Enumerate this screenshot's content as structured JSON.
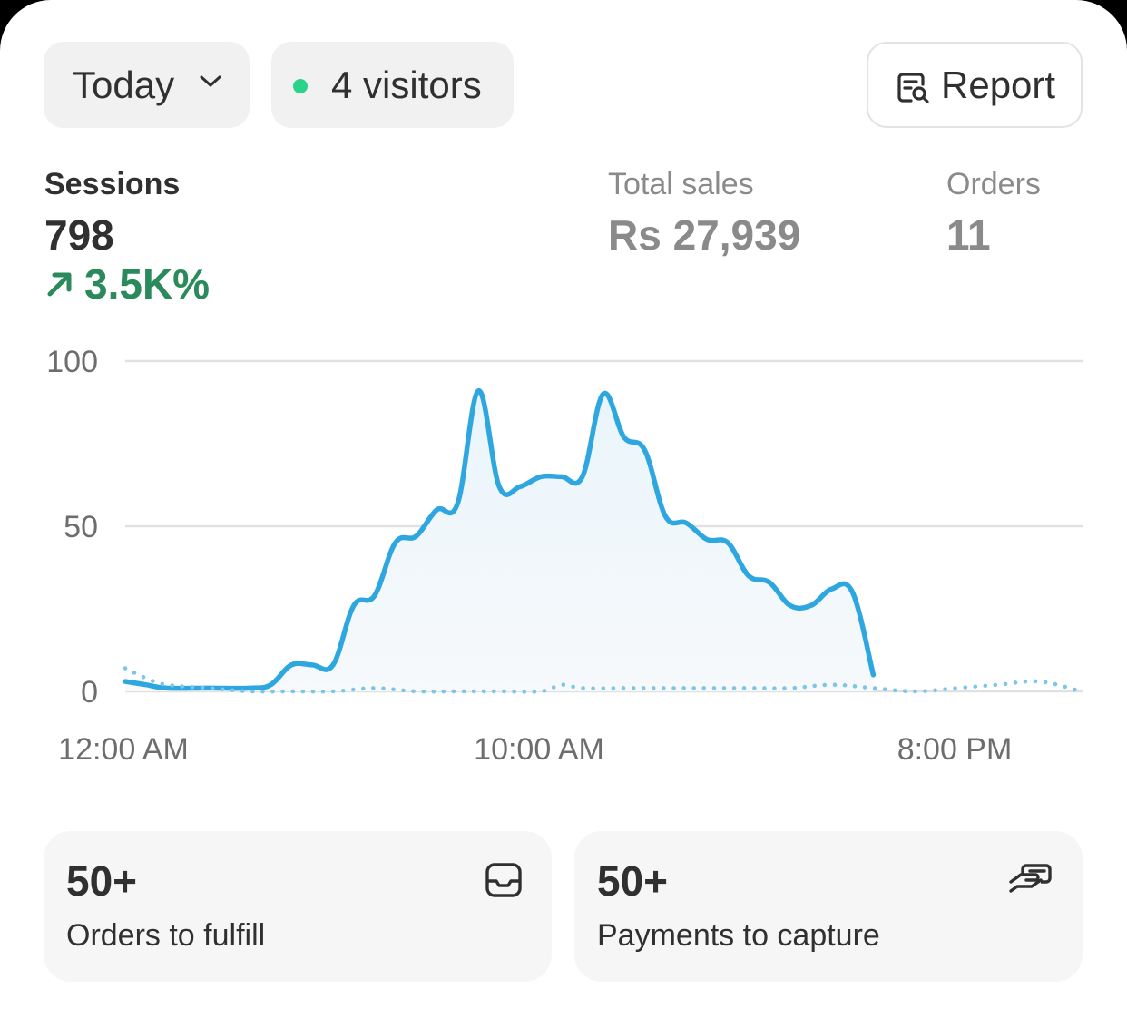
{
  "filters": {
    "date_range": "Today",
    "live_visitors": "4 visitors",
    "live_dot_color": "#29d38a"
  },
  "report_button": {
    "label": "Report",
    "icon": "report-search-icon"
  },
  "metrics": {
    "sessions": {
      "label": "Sessions",
      "value": "798",
      "delta": "3.5K%",
      "delta_color": "#2b8a5c",
      "delta_icon": "arrow-up-right-icon"
    },
    "total_sales": {
      "label": "Total sales",
      "value": "Rs 27,939"
    },
    "orders": {
      "label": "Orders",
      "value": "11"
    }
  },
  "chart_data": {
    "type": "line",
    "y_ticks": [
      "100",
      "50",
      "0"
    ],
    "x_ticks": [
      "12:00 AM",
      "10:00 AM",
      "8:00 PM"
    ],
    "ylim": [
      0,
      100
    ],
    "xlim": [
      0,
      23.5
    ],
    "grid": true,
    "series": [
      {
        "style": "solid-with-area",
        "color": "#2ea7e0",
        "x": [
          0,
          0.5,
          1,
          2,
          3,
          3.5,
          4,
          4.5,
          5,
          5.5,
          6,
          6.5,
          7,
          7.5,
          8,
          8.5,
          9,
          9.5,
          10,
          10.5,
          11,
          11.5,
          12,
          12.5,
          13,
          13.5,
          14,
          14.5,
          15,
          15.5,
          16,
          16.5,
          17,
          17.5,
          18,
          18.5,
          19,
          19.5,
          20
        ],
        "y": [
          3,
          2,
          1,
          1,
          1,
          2,
          8,
          8,
          8,
          26,
          29,
          45,
          47,
          55,
          57,
          91,
          62,
          62,
          65,
          65,
          65,
          90,
          77,
          73,
          53,
          51,
          46,
          45,
          35,
          33,
          26,
          26,
          31,
          30,
          5,
          null,
          null,
          null,
          null
        ]
      },
      {
        "style": "dotted",
        "color": "#7cc6ea",
        "x": [
          0,
          0.5,
          1,
          2,
          3,
          4,
          5,
          6,
          7,
          8,
          9,
          10,
          10.5,
          11,
          12,
          13,
          14,
          15,
          16,
          17,
          18,
          19,
          20,
          21,
          22,
          23
        ],
        "y": [
          7,
          4,
          2,
          1,
          0,
          0,
          0,
          1,
          0,
          0,
          0,
          0,
          2,
          1,
          1,
          1,
          1,
          1,
          1,
          2,
          1,
          0,
          1,
          2,
          3,
          0
        ]
      }
    ]
  },
  "tiles": [
    {
      "count": "50+",
      "label": "Orders to fulfill",
      "icon": "inbox-icon"
    },
    {
      "count": "50+",
      "label": "Payments to capture",
      "icon": "hand-payment-icon"
    }
  ]
}
